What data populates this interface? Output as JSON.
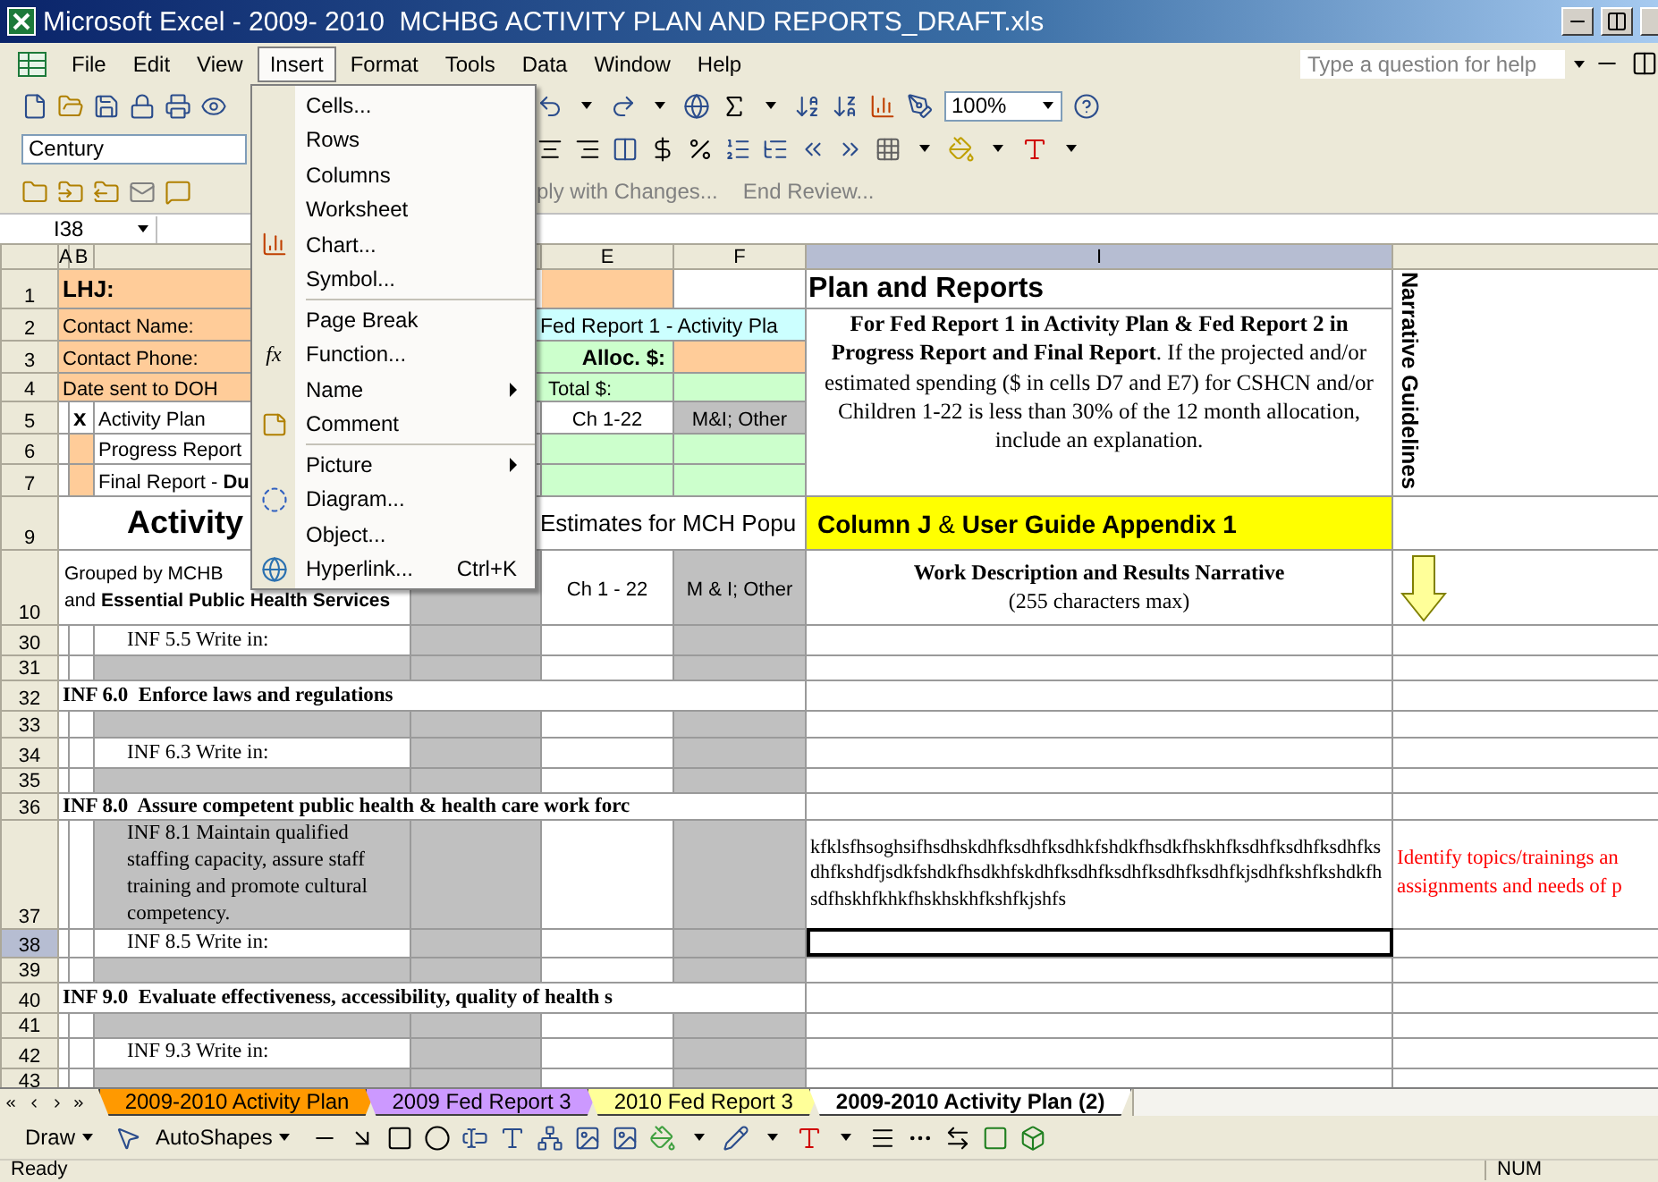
{
  "window": {
    "title": "Microsoft Excel - 2009- 2010  MCHBG ACTIVITY PLAN AND REPORTS_DRAFT.xls"
  },
  "menu_bar": {
    "items": [
      {
        "label": "File",
        "selected": false
      },
      {
        "label": "Edit",
        "selected": false
      },
      {
        "label": "View",
        "selected": false
      },
      {
        "label": "Insert",
        "selected": true
      },
      {
        "label": "Format",
        "selected": false
      },
      {
        "label": "Tools",
        "selected": false
      },
      {
        "label": "Data",
        "selected": false
      },
      {
        "label": "Window",
        "selected": false
      },
      {
        "label": "Help",
        "selected": false
      }
    ],
    "help_box": {
      "placeholder": "Type a question for help"
    }
  },
  "toolbars": {
    "zoom": "100%",
    "font": "Century",
    "review": [
      "ply with Changes...",
      "End Review..."
    ]
  },
  "formula_bar": {
    "name_box": "I38"
  },
  "columns": [
    {
      "label": "A",
      "selected": false
    },
    {
      "label": "B",
      "selected": false
    },
    {
      "selected": false
    },
    {
      "selected": false
    },
    {
      "label": "E",
      "selected": false
    },
    {
      "label": "F",
      "selected": false
    },
    {
      "label": "I",
      "selected": true
    },
    {
      "selected": false
    }
  ],
  "sheet": {
    "rows": [
      {
        "header": "1",
        "selected": false,
        "cells": [
          {
            "color": "#ffcc99",
            "kind": "bold",
            "text": "LHJ:"
          },
          {
            "color": "#ffcc99"
          },
          {
            "color": "#ffcc99"
          },
          {},
          {
            "color": "#ffcc99"
          },
          {},
          {
            "kind": "title",
            "text": "Plan and Reports"
          },
          {
            "kind": "vertical",
            "rowspan": 7,
            "text": "Narrative Guidelines"
          }
        ]
      },
      {
        "header": "2",
        "selected": false,
        "cells": [
          {
            "color": "#ffcc99",
            "kind": "label",
            "colspan": 3,
            "text": "Contact Name:"
          },
          {
            "color": "#ccffff",
            "kind": "offset",
            "colspan": 3,
            "text": "Fed Report 1 - Activity Pla"
          },
          {
            "kind": "note",
            "rowspan": 6,
            "text": "**For Fed Report 1 in Activity Plan & Fed Report 2 in Progress Report and Final Report**.  If the projected and/or estimated spending ($ in cells D7 and E7) for CSHCN and/or Children 1-22 is less than 30% of the 12 month allocation, include an explanation."
          }
        ]
      },
      {
        "header": "3",
        "selected": false,
        "cells": [
          {
            "color": "#ffcc99",
            "kind": "label",
            "colspan": 3,
            "text": "Contact Phone:"
          },
          {
            "color": "#ccffcc",
            "kind": "right-bold",
            "colspan": 2,
            "text": "Alloc. $:"
          },
          {
            "color": "#ffcc99"
          }
        ]
      },
      {
        "header": "4",
        "selected": false,
        "cells": [
          {
            "color": "#ffcc99",
            "kind": "label",
            "colspan": 3,
            "text": "Date sent to DOH"
          },
          {
            "color": "#ccffcc",
            "kind": "right",
            "colspan": 2,
            "text": "Total $:"
          },
          {
            "color": "#ccffcc"
          }
        ]
      },
      {
        "header": "5",
        "selected": false,
        "cells": [
          {},
          {
            "kind": "bold",
            "text": "x"
          },
          {
            "kind": "label",
            "text": "Activity Plan"
          },
          {},
          {
            "kind": "center",
            "text": "Ch 1-22"
          },
          {
            "color": "#c0c0c0",
            "kind": "center",
            "text": "M&I; Other"
          }
        ]
      },
      {
        "header": "6",
        "selected": false,
        "cells": [
          {},
          {
            "color": "#ffcc99"
          },
          {
            "kind": "label",
            "text": "Progress Report"
          },
          {},
          {
            "color": "#ccffcc"
          },
          {
            "color": "#ccffcc"
          }
        ]
      },
      {
        "header": "7",
        "selected": false,
        "cells": [
          {},
          {
            "color": "#ffcc99"
          },
          {
            "kind": "label",
            "text": "Final Report - **Du**"
          },
          {},
          {
            "color": "#ccffcc"
          },
          {
            "color": "#ccffcc"
          }
        ]
      },
      {
        "header": "9",
        "selected": false,
        "cells": [
          {
            "kind": "heading",
            "colspan": 3,
            "text": "Activity"
          },
          {
            "kind": "offset-large",
            "colspan": 3,
            "text": "Estimates for MCH Popu"
          },
          {
            "color": "#ffff00",
            "kind": "banner",
            "text": "**Column J** & **User Guide Appendix 1**"
          },
          {}
        ]
      },
      {
        "header": "10",
        "selected": false,
        "cells": [
          {
            "kind": "group-note",
            "colspan": 3,
            "lines": [
              "Grouped by MCHB",
              "and **Essential Public Health Services**"
            ]
          },
          {
            "color": "#c0c0c0"
          },
          {
            "kind": "center",
            "text": "Ch 1 - 22"
          },
          {
            "color": "#c0c0c0",
            "kind": "center",
            "text": "M & I; Other"
          },
          {
            "kind": "column-head",
            "lines": [
              "**Work Description and Results Narrative**",
              "(255 characters max)"
            ]
          },
          {
            "kind": "arrow"
          }
        ]
      },
      {
        "header": "30",
        "selected": false,
        "cells": [
          {},
          {},
          {
            "kind": "item",
            "text": "INF 5.5 Write in:"
          },
          {
            "color": "#c0c0c0"
          },
          {},
          {
            "color": "#c0c0c0"
          },
          {},
          {}
        ]
      },
      {
        "header": "31",
        "selected": false,
        "cells": [
          {},
          {},
          {
            "color": "#c0c0c0"
          },
          {
            "color": "#c0c0c0"
          },
          {},
          {
            "color": "#c0c0c0"
          },
          {},
          {}
        ]
      },
      {
        "header": "32",
        "selected": false,
        "cells": [
          {
            "kind": "section",
            "colspan": 6,
            "text": "INF 6.0  Enforce laws and regulations"
          },
          {},
          {}
        ]
      },
      {
        "header": "33",
        "selected": false,
        "cells": [
          {},
          {},
          {
            "color": "#c0c0c0"
          },
          {
            "color": "#c0c0c0"
          },
          {},
          {
            "color": "#c0c0c0"
          },
          {},
          {}
        ]
      },
      {
        "header": "34",
        "selected": false,
        "cells": [
          {},
          {},
          {
            "kind": "item",
            "text": "INF 6.3 Write in:"
          },
          {
            "color": "#c0c0c0"
          },
          {},
          {
            "color": "#c0c0c0"
          },
          {},
          {}
        ]
      },
      {
        "header": "35",
        "selected": false,
        "cells": [
          {},
          {},
          {
            "color": "#c0c0c0"
          },
          {
            "color": "#c0c0c0"
          },
          {},
          {
            "color": "#c0c0c0"
          },
          {},
          {}
        ]
      },
      {
        "header": "36",
        "selected": false,
        "cells": [
          {
            "kind": "section",
            "colspan": 6,
            "text": "INF 8.0  Assure competent public health & health care work forc"
          },
          {},
          {}
        ]
      },
      {
        "header": "37",
        "selected": false,
        "cells": [
          {},
          {},
          {
            "color": "#c0c0c0",
            "kind": "item",
            "text": "INF 8.1  Maintain qualified staffing capacity, assure staff training and promote cultural competency."
          },
          {
            "color": "#c0c0c0"
          },
          {},
          {
            "color": "#c0c0c0"
          },
          {
            "kind": "narrative",
            "text": "kfklsfhsoghsifhsdhskdhfksdhfksdhkfshdkfhsdkfhskhfksdhfksdhfksdhfksdhfkshdfjsdkfshdkfhsdkhfskdhfksdhfksdhfksdhfksdhfkjsdhfkshfkshdkfhsdfhskhfkhkfhskhskhfkshfkjshfs"
          },
          {
            "kind": "guideline",
            "lines": [
              "Identify topics/trainings an",
              "assignments and needs of p"
            ]
          }
        ]
      },
      {
        "header": "38",
        "selected": true,
        "cells": [
          {},
          {},
          {
            "kind": "item",
            "text": "INF 8.5 Write in:"
          },
          {
            "color": "#c0c0c0"
          },
          {},
          {
            "color": "#c0c0c0"
          },
          {},
          {}
        ]
      },
      {
        "header": "39",
        "selected": false,
        "cells": [
          {},
          {},
          {
            "color": "#c0c0c0"
          },
          {
            "color": "#c0c0c0"
          },
          {},
          {
            "color": "#c0c0c0"
          },
          {},
          {}
        ]
      },
      {
        "header": "40",
        "selected": false,
        "cells": [
          {
            "kind": "section",
            "colspan": 6,
            "text": "INF 9.0  Evaluate effectiveness, accessibility, quality of health s"
          },
          {},
          {}
        ]
      },
      {
        "header": "41",
        "selected": false,
        "cells": [
          {},
          {},
          {
            "color": "#c0c0c0"
          },
          {
            "color": "#c0c0c0"
          },
          {},
          {
            "color": "#c0c0c0"
          },
          {},
          {}
        ]
      },
      {
        "header": "42",
        "selected": false,
        "cells": [
          {},
          {},
          {
            "kind": "item",
            "text": "INF 9.3 Write in:"
          },
          {
            "color": "#c0c0c0"
          },
          {},
          {
            "color": "#c0c0c0"
          },
          {},
          {}
        ]
      },
      {
        "header": "43",
        "selected": false,
        "cells": [
          {},
          {},
          {
            "color": "#c0c0c0"
          },
          {
            "color": "#c0c0c0"
          },
          {},
          {
            "color": "#c0c0c0"
          },
          {},
          {}
        ]
      }
    ]
  },
  "insert_menu": {
    "items": [
      {
        "label": "Cells...",
        "kind": "plain"
      },
      {
        "label": "Rows",
        "kind": "plain"
      },
      {
        "label": "Columns",
        "kind": "plain"
      },
      {
        "label": "Worksheet",
        "kind": "plain"
      },
      {
        "label": "Chart...",
        "kind": "chart"
      },
      {
        "label": "Symbol...",
        "kind": "plain",
        "separator_after": true
      },
      {
        "label": "Page Break",
        "kind": "plain"
      },
      {
        "label": "Function...",
        "kind": "function",
        "glyph": "fx"
      },
      {
        "label": "Name",
        "kind": "submenu"
      },
      {
        "label": "Comment",
        "kind": "comment",
        "separator_after": true
      },
      {
        "label": "Picture",
        "kind": "submenu"
      },
      {
        "label": "Diagram...",
        "kind": "diagram"
      },
      {
        "label": "Object...",
        "kind": "plain"
      },
      {
        "label": "Hyperlink...",
        "kind": "hyperlink",
        "shortcut": "Ctrl+K"
      }
    ]
  },
  "sheet_tabs": [
    {
      "label": "2009-2010 Activity Plan",
      "color": "#ff9900",
      "selected": false
    },
    {
      "label": "2009 Fed Report 3",
      "color": "#cc99ff",
      "selected": false
    },
    {
      "label": "2010 Fed Report 3",
      "color": "#ffff99",
      "selected": false
    },
    {
      "label": "2009-2010 Activity Plan (2)",
      "selected": true
    }
  ],
  "draw_toolbar": {
    "draw": "Draw",
    "autoshapes": "AutoShapes"
  },
  "status_bar": {
    "left": "Ready",
    "num": "NUM"
  }
}
